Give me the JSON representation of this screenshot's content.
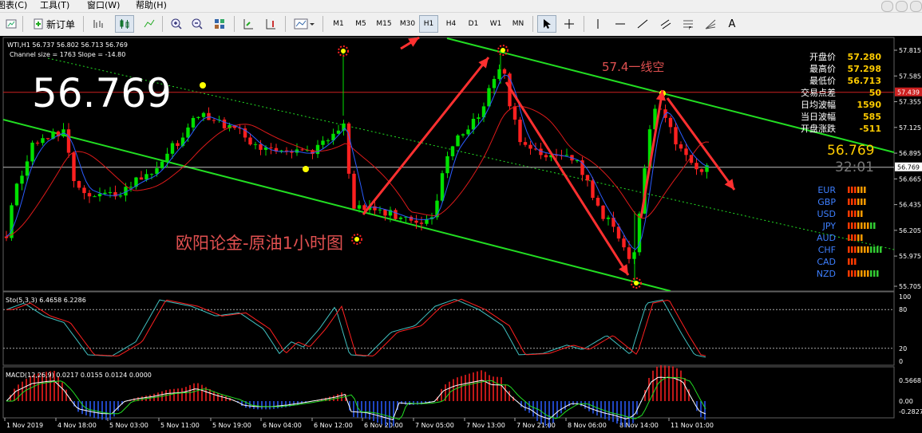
{
  "menu": {
    "items": [
      "图表(C)",
      "工具(T)",
      "窗口(W)",
      "帮助(H)"
    ]
  },
  "toolbar": {
    "new_order": "新订单",
    "timeframes": [
      "M1",
      "M5",
      "M15",
      "M30",
      "H1",
      "H4",
      "D1",
      "W1",
      "MN"
    ],
    "active_timeframe": "H1"
  },
  "chart": {
    "info_line": "WTI,H1  56.737 56.802 56.713 56.769",
    "channel_line": "Channel size = 1763 Slope = -14.80",
    "big_price": "56.769",
    "annotation_main": "欧阳论金-原油1小时图",
    "annotation_sell": "57.4一线空",
    "corner_price": "56.769",
    "countdown": "32:01",
    "bid_label": "56.769",
    "line_label": "57.439"
  },
  "stats": [
    {
      "label": "开盘价",
      "value": "57.280"
    },
    {
      "label": "最高价",
      "value": "57.298"
    },
    {
      "label": "最低价",
      "value": "56.713"
    },
    {
      "label": "交易点差",
      "value": "50"
    },
    {
      "label": "日均波幅",
      "value": "1590"
    },
    {
      "label": "当日波幅",
      "value": "585"
    },
    {
      "label": "开盘涨跌",
      "value": "-511"
    }
  ],
  "strength": [
    {
      "cur": "EUR",
      "bars": 6
    },
    {
      "cur": "GBP",
      "bars": 6
    },
    {
      "cur": "USD",
      "bars": 5
    },
    {
      "cur": "JPY",
      "bars": 9
    },
    {
      "cur": "AUD",
      "bars": 5
    },
    {
      "cur": "CHF",
      "bars": 11
    },
    {
      "cur": "CAD",
      "bars": 3
    },
    {
      "cur": "NZD",
      "bars": 10
    }
  ],
  "price_axis": [
    "57.815",
    "57.585",
    "57.355",
    "57.125",
    "56.895",
    "56.665",
    "56.435",
    "56.205",
    "55.975",
    "55.705"
  ],
  "stoch": {
    "label": "Sto(5,3,3) 6.4658 6.2286",
    "levels": [
      "100",
      "80",
      "20",
      "0"
    ]
  },
  "macd": {
    "label": "MACD(12,26,9) 0.0217 0.0155 0.0124 0.0000",
    "levels": [
      "0.5668",
      "0.00",
      "-0.2827"
    ]
  },
  "time_axis": [
    "1 Nov 2019",
    "4 Nov 18:00",
    "5 Nov 03:00",
    "5 Nov 11:00",
    "5 Nov 19:00",
    "6 Nov 04:00",
    "6 Nov 12:00",
    "6 Nov 20:00",
    "7 Nov 05:00",
    "7 Nov 13:00",
    "7 Nov 21:00",
    "8 Nov 06:00",
    "8 Nov 14:00",
    "11 Nov 01:00"
  ],
  "colors": {
    "up": "#00e000",
    "down": "#ff2020",
    "channel": "#22dd22",
    "arrow": "#ff3030",
    "label_text": "#e05050",
    "stat_value": "#ffcc00"
  }
}
